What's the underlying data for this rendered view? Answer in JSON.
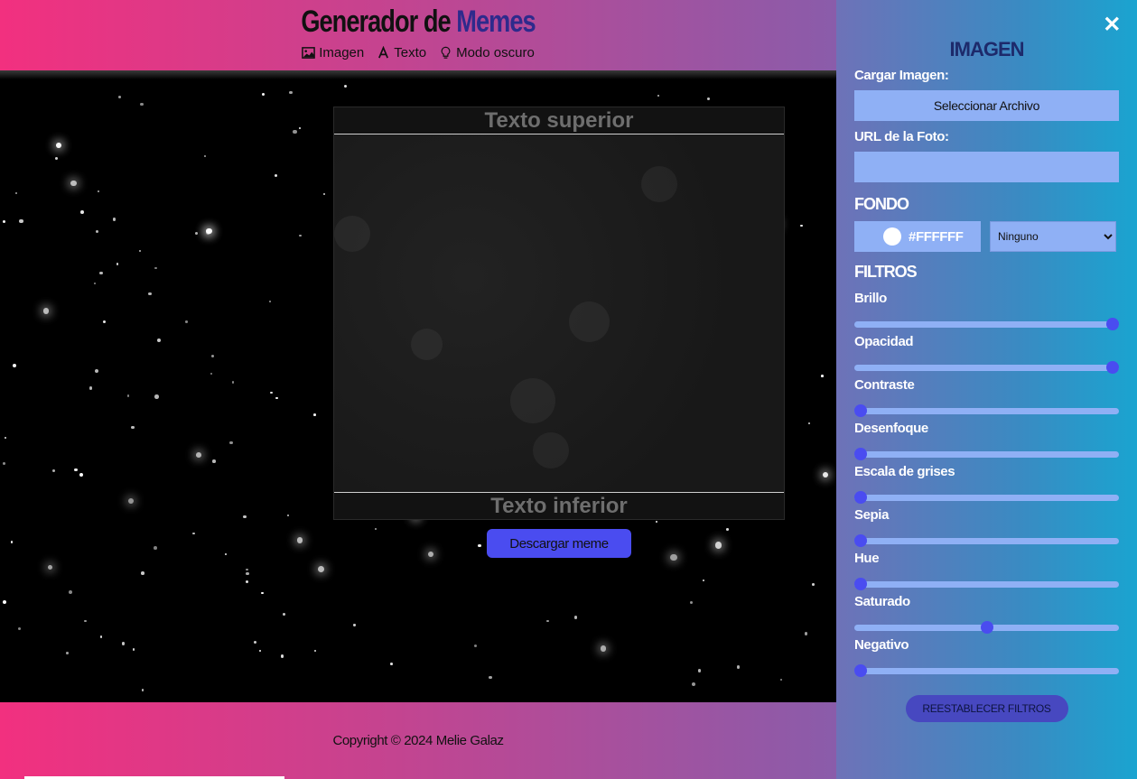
{
  "header": {
    "title_part1": "Generador de",
    "title_part2": "Memes",
    "nav": [
      {
        "label": "Imagen",
        "icon": "image-icon"
      },
      {
        "label": "Texto",
        "icon": "text-icon"
      },
      {
        "label": "Modo oscuro",
        "icon": "lightbulb-icon"
      }
    ]
  },
  "meme": {
    "top_text": "Texto superior",
    "bottom_text": "Texto inferior",
    "download_label": "Descargar meme"
  },
  "footer": {
    "copyright": "Copyright © 2024 Melie Galaz"
  },
  "panel": {
    "close_label": "✕",
    "title": "IMAGEN",
    "upload_label": "Cargar Imagen:",
    "upload_button": "Seleccionar Archivo",
    "url_label": "URL de la Foto:",
    "url_value": "",
    "fondo_title": "FONDO",
    "color_value": "#FFFFFF",
    "blend_selected": "Ninguno",
    "filtros_title": "FILTROS",
    "filters": [
      {
        "label": "Brillo",
        "value": 1.0
      },
      {
        "label": "Opacidad",
        "value": 1.0
      },
      {
        "label": "Contraste",
        "value": 0.0
      },
      {
        "label": "Desenfoque",
        "value": 0.0
      },
      {
        "label": "Escala de grises",
        "value": 0.0
      },
      {
        "label": "Sepia",
        "value": 0.0
      },
      {
        "label": "Hue",
        "value": 0.0
      },
      {
        "label": "Saturado",
        "value": 0.5
      },
      {
        "label": "Negativo",
        "value": 0.0
      }
    ],
    "reset_label": "REESTABLECER FILTROS"
  },
  "colors": {
    "gradient_start": "#f2307f",
    "panel_blue": "#1aa4d0",
    "accent": "#4a4cf0",
    "input_bg": "#8fb0f5"
  }
}
